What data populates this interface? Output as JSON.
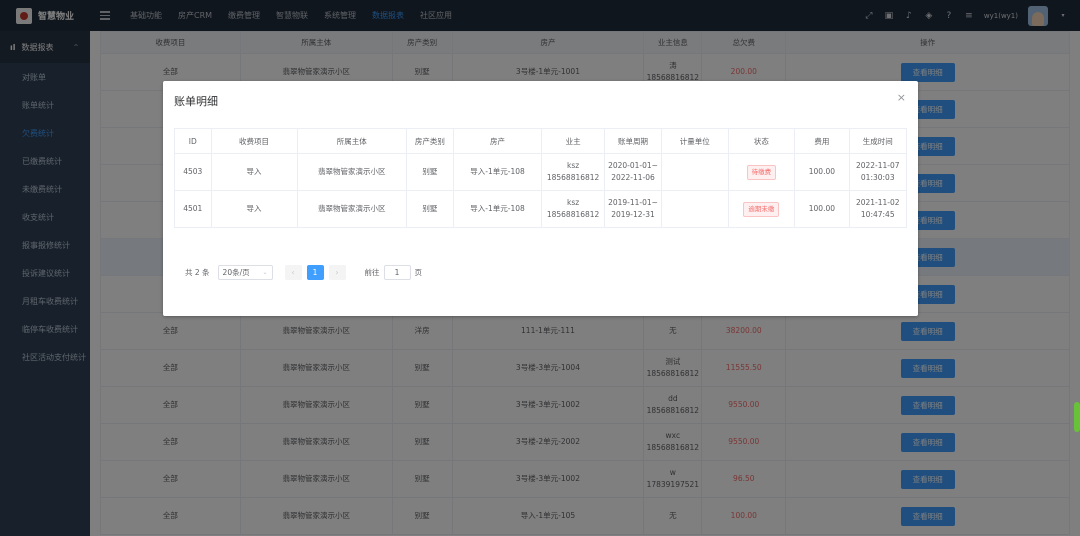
{
  "app": {
    "brand": "智慧物业"
  },
  "topnav": [
    "基础功能",
    "房产CRM",
    "缴费管理",
    "智慧物联",
    "系统管理",
    "数据报表",
    "社区应用"
  ],
  "topnav_active": 5,
  "user": {
    "name": "wy1(wy1)"
  },
  "sidebar": {
    "header": "数据报表",
    "items": [
      "对账单",
      "账单统计",
      "欠费统计",
      "已缴费统计",
      "未缴费统计",
      "收支统计",
      "报事报修统计",
      "投诉建议统计",
      "月租车收费统计",
      "临停车收费统计",
      "社区活动支付统计"
    ],
    "active_index": 2
  },
  "bg_table": {
    "headers": [
      "收费项目",
      "所属主体",
      "房产类别",
      "房产",
      "业主信息",
      "总欠费",
      "操作"
    ],
    "rows": [
      {
        "item": "全部",
        "owner_entity": "翡翠物管家演示小区",
        "type": "别墅",
        "house": "3号楼-1单元-1001",
        "info": "涛",
        "info2": "18568816812",
        "due": "200.00"
      },
      {
        "item": "",
        "owner_entity": "",
        "type": "",
        "house": "",
        "info": "",
        "info2": "",
        "due": ""
      },
      {
        "item": "",
        "owner_entity": "",
        "type": "",
        "house": "",
        "info": "",
        "info2": "",
        "due": ""
      },
      {
        "item": "",
        "owner_entity": "",
        "type": "",
        "house": "",
        "info": "",
        "info2": "",
        "due": ""
      },
      {
        "item": "",
        "owner_entity": "",
        "type": "",
        "house": "",
        "info": "",
        "info2": "",
        "due": ""
      },
      {
        "item": "",
        "owner_entity": "",
        "type": "",
        "house": "",
        "info": "",
        "info2": "",
        "due": ""
      },
      {
        "item": "",
        "owner_entity": "",
        "type": "",
        "house": "",
        "info": "",
        "info2": "",
        "due": ""
      },
      {
        "item": "全部",
        "owner_entity": "翡翠物管家演示小区",
        "type": "洋房",
        "house": "111-1单元-111",
        "info": "无",
        "info2": "",
        "due": "38200.00"
      },
      {
        "item": "全部",
        "owner_entity": "翡翠物管家演示小区",
        "type": "别墅",
        "house": "3号楼-3单元-1004",
        "info": "测试",
        "info2": "18568816812",
        "due": "11555.50"
      },
      {
        "item": "全部",
        "owner_entity": "翡翠物管家演示小区",
        "type": "别墅",
        "house": "3号楼-3单元-1002",
        "info": "dd",
        "info2": "18568816812",
        "due": "9550.00"
      },
      {
        "item": "全部",
        "owner_entity": "翡翠物管家演示小区",
        "type": "别墅",
        "house": "3号楼-2单元-2002",
        "info": "wxc",
        "info2": "18568816812",
        "due": "9550.00"
      },
      {
        "item": "全部",
        "owner_entity": "翡翠物管家演示小区",
        "type": "别墅",
        "house": "3号楼-3单元-1002",
        "info": "w",
        "info2": "17839197521",
        "due": "96.50"
      },
      {
        "item": "全部",
        "owner_entity": "翡翠物管家演示小区",
        "type": "别墅",
        "house": "导入-1单元-105",
        "info": "无",
        "info2": "",
        "due": "100.00"
      }
    ],
    "action_label": "查看明细"
  },
  "dialog": {
    "title": "账单明细",
    "headers": [
      "ID",
      "收费项目",
      "所属主体",
      "房产类别",
      "房产",
      "业主",
      "账单周期",
      "计量单位",
      "状态",
      "费用",
      "生成时间"
    ],
    "rows": [
      {
        "id": "4503",
        "item": "导入",
        "entity": "翡翠物管家演示小区",
        "type": "别墅",
        "house": "导入-1单元-108",
        "owner": "ksz",
        "phone": "18568816812",
        "period_start": "2020-01-01~",
        "period_end": "2022-11-06",
        "unit": "",
        "status": "待缴费",
        "fee": "100.00",
        "date": "2022-11-07",
        "time": "01:30:03"
      },
      {
        "id": "4501",
        "item": "导入",
        "entity": "翡翠物管家演示小区",
        "type": "别墅",
        "house": "导入-1单元-108",
        "owner": "ksz",
        "phone": "18568816812",
        "period_start": "2019-11-01~",
        "period_end": "2019-12-31",
        "unit": "",
        "status": "逾期未缴",
        "fee": "100.00",
        "date": "2021-11-02",
        "time": "10:47:45"
      }
    ],
    "pager": {
      "total": "共 2 条",
      "page_size": "20条/页",
      "current": "1",
      "goto_label": "前往",
      "goto_value": "1",
      "page_suffix": "页"
    }
  }
}
